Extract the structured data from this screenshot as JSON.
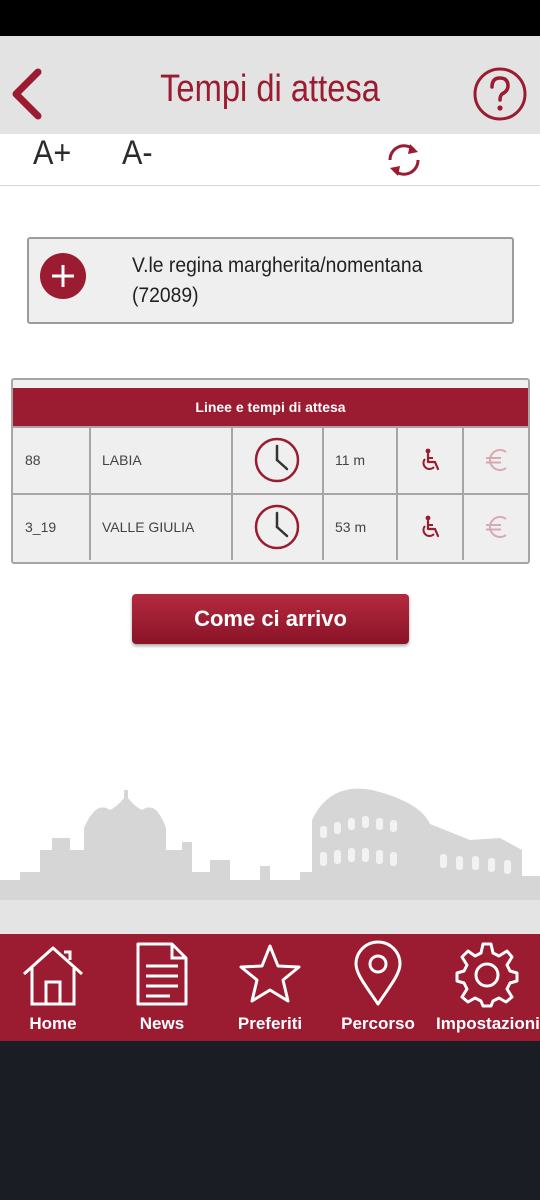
{
  "header": {
    "title": "Tempi di attesa"
  },
  "font_controls": {
    "increase_label": "A+",
    "decrease_label": "A-"
  },
  "stop": {
    "name": "V.le regina margherita/nomentana (72089)"
  },
  "table": {
    "title": "Linee e tempi di attesa",
    "rows": [
      {
        "line": "88",
        "destination": "LABIA",
        "wait": "11 m"
      },
      {
        "line": "3_19",
        "destination": "VALLE GIULIA",
        "wait": "53 m"
      }
    ]
  },
  "directions_button": {
    "label": "Come ci arrivo"
  },
  "bottom_nav": {
    "items": [
      {
        "label": "Home",
        "icon": "home-icon"
      },
      {
        "label": "News",
        "icon": "document-icon"
      },
      {
        "label": "Preferiti",
        "icon": "star-icon"
      },
      {
        "label": "Percorso",
        "icon": "map-pin-icon"
      },
      {
        "label": "Impostazioni",
        "icon": "gear-icon"
      }
    ]
  },
  "colors": {
    "brand": "#9b1b30",
    "header_bg": "#e3e3e3",
    "card_bg": "#efefef",
    "system_bar": "#1b1d24"
  }
}
